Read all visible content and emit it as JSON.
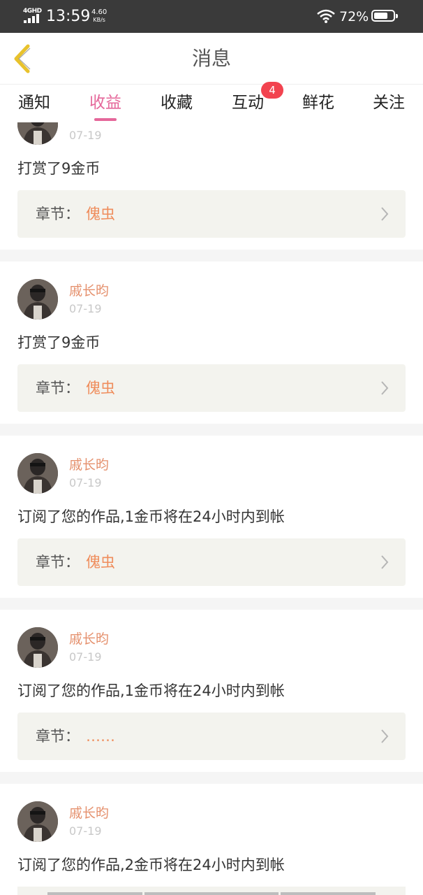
{
  "status_bar": {
    "network_type": "4GHD",
    "time": "13:59",
    "speed_value": "4.60",
    "speed_unit": "KB/s",
    "battery": "72%",
    "battery_level": 0.72
  },
  "header": {
    "title": "消息",
    "back_icon": "chevron-left-icon",
    "accent_color": "#e5679a",
    "back_color": "#e8c22c"
  },
  "tabs": [
    {
      "label": "通知",
      "active": false
    },
    {
      "label": "收益",
      "active": true
    },
    {
      "label": "收藏",
      "active": false
    },
    {
      "label": "互动",
      "active": false,
      "badge": "4"
    },
    {
      "label": "鲜花",
      "active": false
    },
    {
      "label": "关注",
      "active": false
    }
  ],
  "chapter_label": "章节：",
  "messages": [
    {
      "user": "",
      "date": "07-19",
      "text": "打赏了9金币",
      "chapter": "傀虫"
    },
    {
      "user": "戚长昀",
      "date": "07-19",
      "text": "打赏了9金币",
      "chapter": "傀虫"
    },
    {
      "user": "戚长昀",
      "date": "07-19",
      "text": "订阅了您的作品,1金币将在24小时内到帐",
      "chapter": "傀虫"
    },
    {
      "user": "戚长昀",
      "date": "07-19",
      "text": "订阅了您的作品,1金币将在24小时内到帐",
      "chapter": "……"
    },
    {
      "user": "戚长昀",
      "date": "07-19",
      "text": "订阅了您的作品,2金币将在24小时内到帐",
      "chapter": ""
    }
  ]
}
